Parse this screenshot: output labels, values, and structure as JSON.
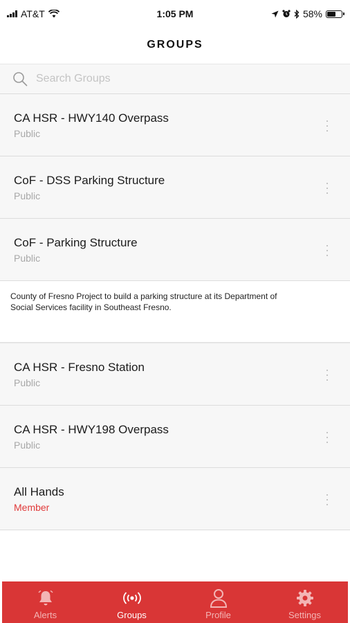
{
  "status_bar": {
    "carrier": "AT&T",
    "time": "1:05 PM",
    "battery_percent": "58%",
    "battery_level": 0.58
  },
  "header": {
    "title": "GROUPS"
  },
  "search": {
    "placeholder": "Search Groups",
    "value": ""
  },
  "groups": [
    {
      "name": "CA HSR - HWY140 Overpass",
      "type": "Public"
    },
    {
      "name": "CoF - DSS Parking Structure",
      "type": "Public"
    },
    {
      "name": "CoF - Parking Structure",
      "type": "Public"
    },
    {
      "name": "CA HSR - Fresno Station",
      "type": "Public"
    },
    {
      "name": "CA HSR - HWY198 Overpass",
      "type": "Public"
    },
    {
      "name": "All Hands",
      "type": "Member"
    }
  ],
  "expanded_description": "County of Fresno Project to build a parking structure at its Department of Social Services facility in Southeast Fresno.",
  "tabs": [
    {
      "label": "Alerts",
      "icon": "bell-icon",
      "active": false
    },
    {
      "label": "Groups",
      "icon": "broadcast-icon",
      "active": true
    },
    {
      "label": "Profile",
      "icon": "person-icon",
      "active": false
    },
    {
      "label": "Settings",
      "icon": "gear-icon",
      "active": false
    }
  ],
  "colors": {
    "accent": "#d93636",
    "member_label": "#e03a3a",
    "row_background": "#f7f7f7"
  }
}
